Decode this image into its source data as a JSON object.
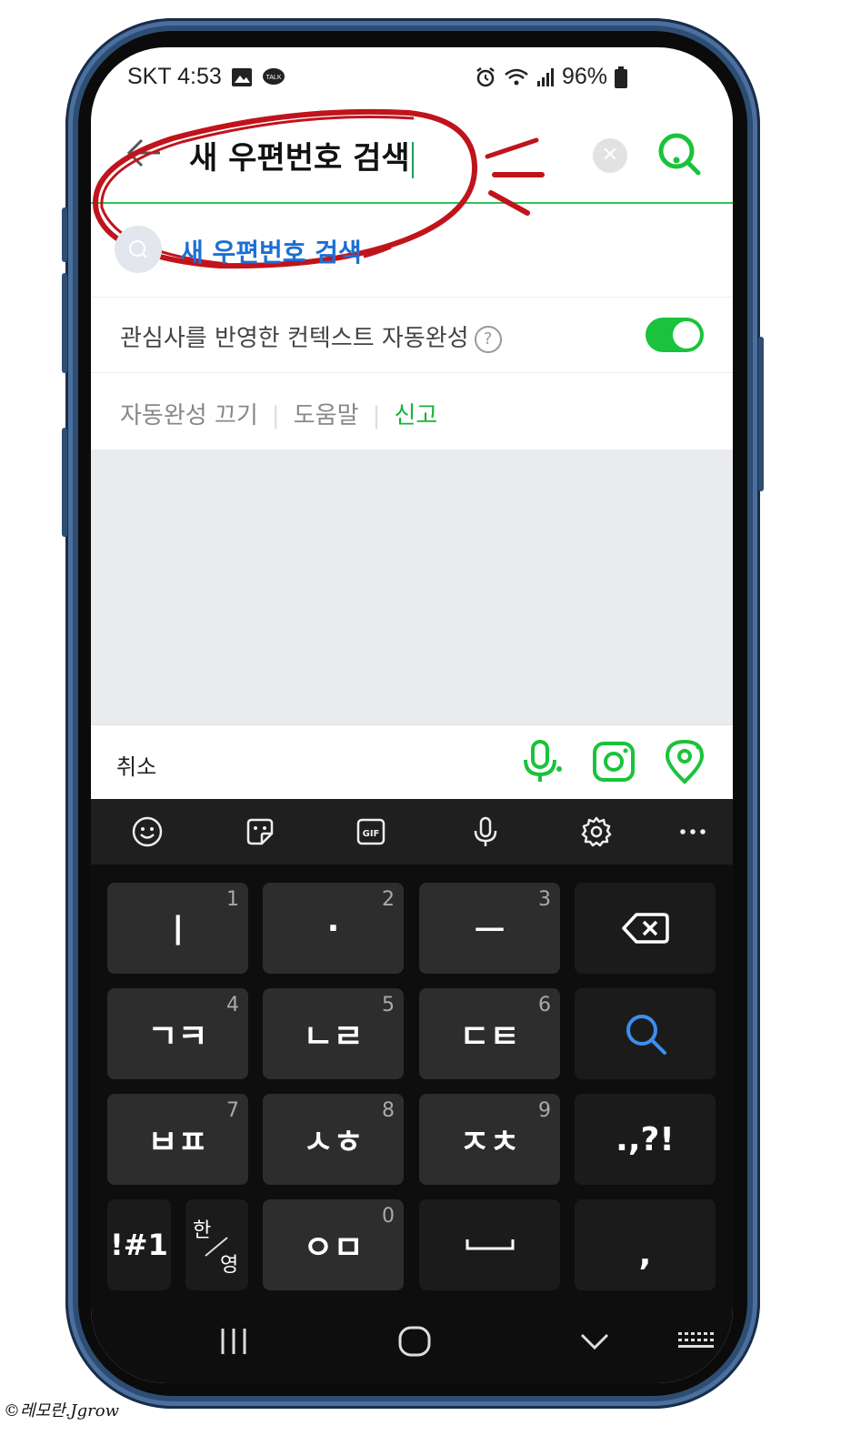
{
  "status_bar": {
    "carrier_time": "SKT 4:53",
    "battery": "96%"
  },
  "search": {
    "query": "새 우편번호 검색"
  },
  "suggestion": {
    "text": "새 우편번호 검색"
  },
  "context_toggle": {
    "label": "관심사를 반영한 컨텍스트 자동완성",
    "help": "?",
    "enabled": true
  },
  "links": {
    "autocomplete_off": "자동완성 끄기",
    "help": "도움말",
    "report": "신고",
    "separator": "|"
  },
  "action_bar": {
    "cancel": "취소"
  },
  "keyboard": {
    "rows": [
      [
        {
          "main": "ㅣ",
          "num": "1"
        },
        {
          "main": "·",
          "num": "2"
        },
        {
          "main": "ㅡ",
          "num": "3"
        },
        {
          "main": "⌫",
          "num": ""
        }
      ],
      [
        {
          "main": "ㄱㅋ",
          "num": "4"
        },
        {
          "main": "ㄴㄹ",
          "num": "5"
        },
        {
          "main": "ㄷㅌ",
          "num": "6"
        },
        {
          "main": "search",
          "num": ""
        }
      ],
      [
        {
          "main": "ㅂㅍ",
          "num": "7"
        },
        {
          "main": "ㅅㅎ",
          "num": "8"
        },
        {
          "main": "ㅈㅊ",
          "num": "9"
        },
        {
          "main": ".,?!",
          "num": ""
        }
      ]
    ],
    "bottom": {
      "symbols": "!#1",
      "lang_top": "한",
      "lang_bottom": "영",
      "om": "ㅇㅁ",
      "om_num": "0",
      "comma": ","
    }
  },
  "watermark": "©레모란.Jgrow",
  "colors": {
    "accent_green": "#19c33b",
    "link_blue": "#1c6fd4",
    "annotation_red": "#c0141c"
  }
}
